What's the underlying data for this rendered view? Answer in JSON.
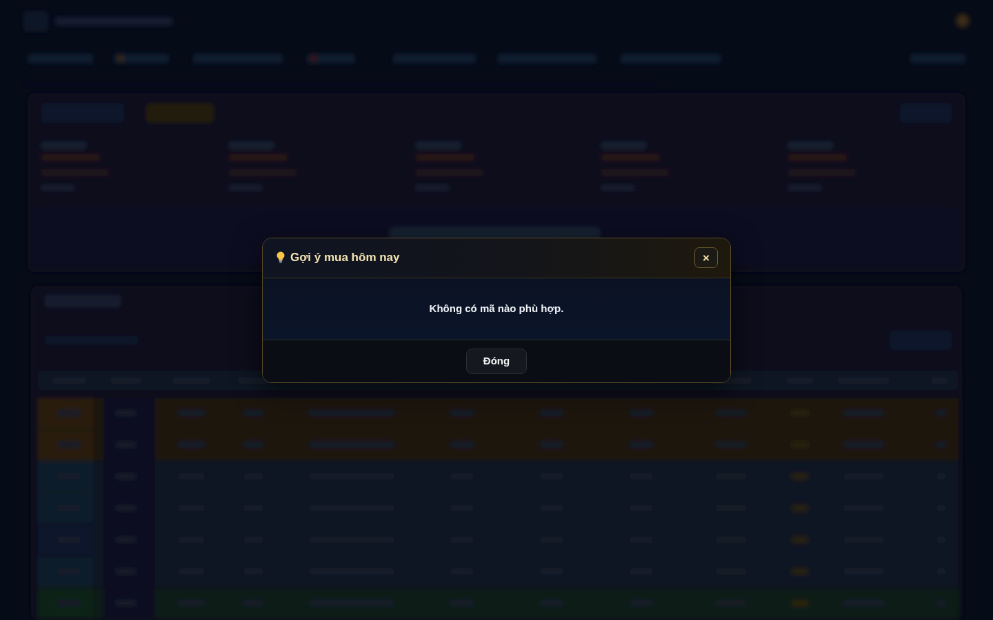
{
  "modal": {
    "title": "Gợi ý mua hôm nay",
    "close_glyph": "×",
    "message": "Không có mã nào phù hợp.",
    "buttons": [
      "Đóng"
    ]
  }
}
